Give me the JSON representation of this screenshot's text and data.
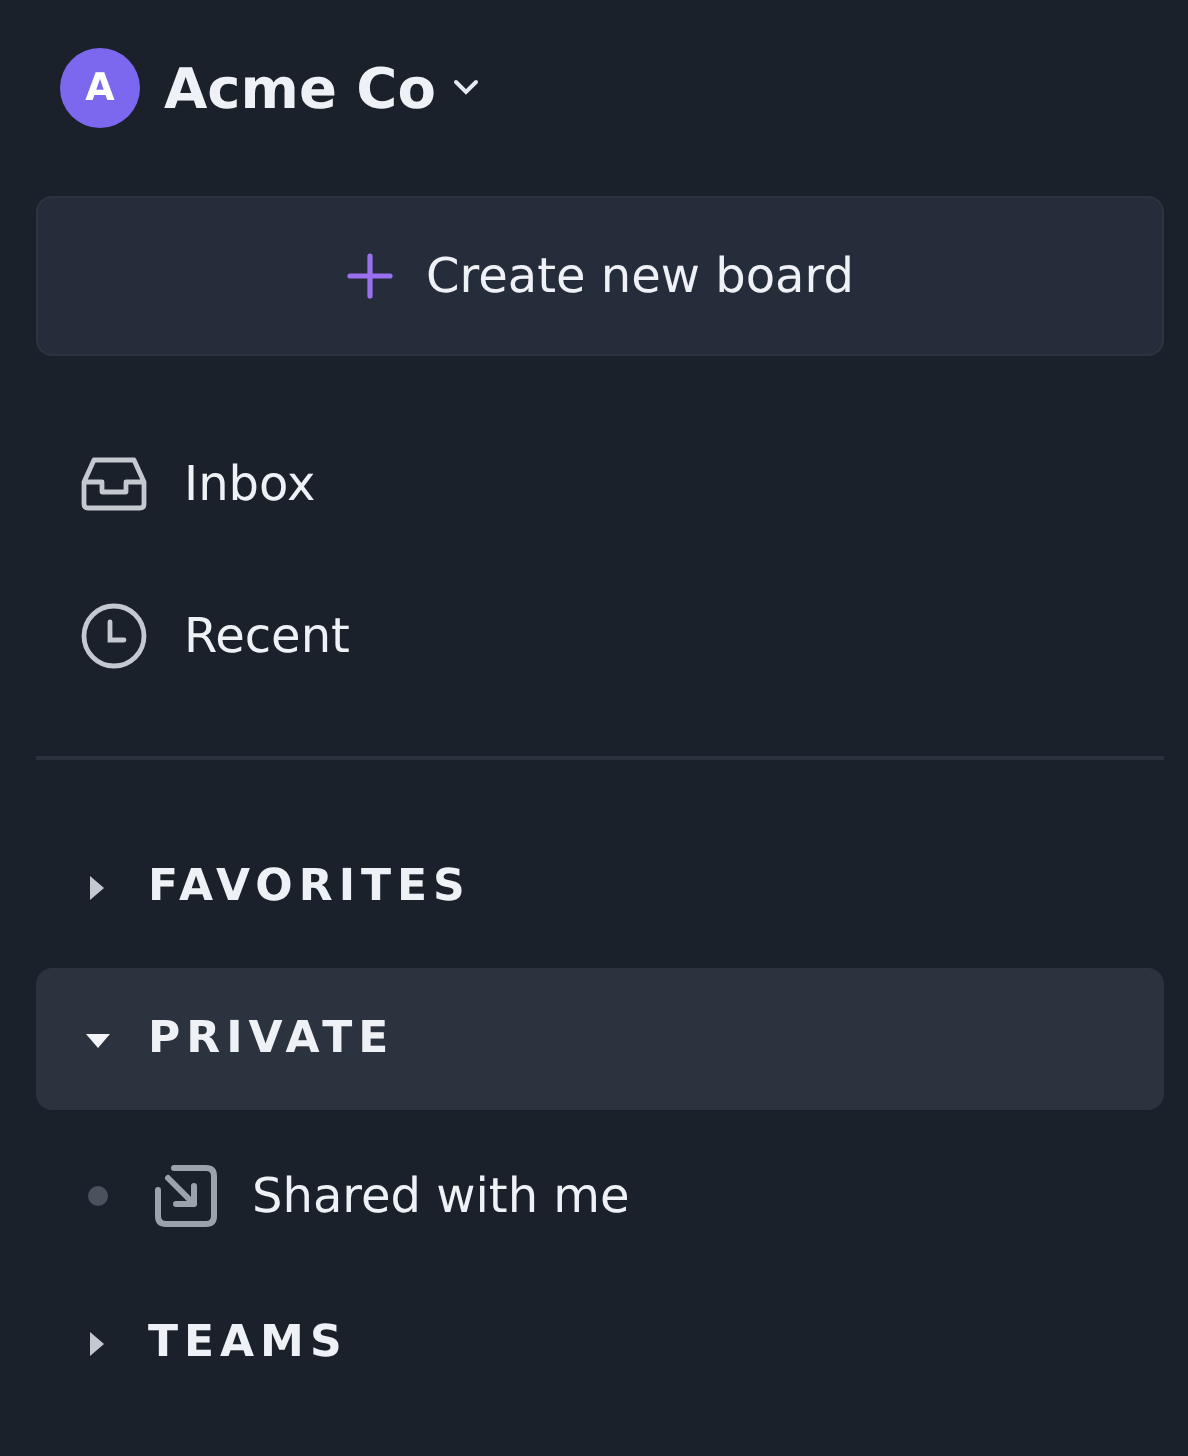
{
  "workspace": {
    "avatar": "A",
    "name": "Acme Co"
  },
  "create_button": {
    "label": "Create new board"
  },
  "nav": [
    {
      "kind": "inbox",
      "label": "Inbox"
    },
    {
      "kind": "recent",
      "label": "Recent"
    }
  ],
  "sections": [
    {
      "label": "FAVORITES",
      "expanded": false,
      "selected": false
    },
    {
      "label": "PRIVATE",
      "expanded": true,
      "selected": true,
      "children": [
        {
          "kind": "shared",
          "label": "Shared with me"
        }
      ]
    },
    {
      "label": "TEAMS",
      "expanded": false,
      "selected": false
    }
  ]
}
